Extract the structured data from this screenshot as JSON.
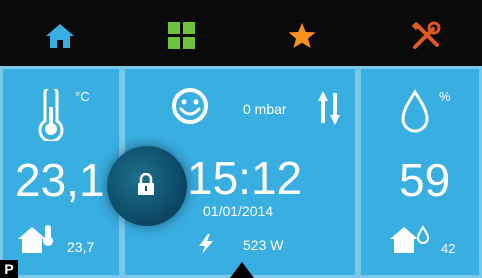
{
  "nav": {
    "items": [
      {
        "name": "home",
        "icon": "home-icon",
        "color": "#39aee0"
      },
      {
        "name": "grid",
        "icon": "grid-icon",
        "color": "#71c23b"
      },
      {
        "name": "favorites",
        "icon": "star-icon",
        "color": "#f6921e"
      },
      {
        "name": "settings",
        "icon": "tools-icon",
        "color": "#e05a1e"
      }
    ]
  },
  "left": {
    "unit": "°C",
    "temperature": "23,1",
    "inside_temp": "23,7"
  },
  "middle": {
    "pressure": "0 mbar",
    "time": "15:12",
    "date": "01/01/2014",
    "power": "523 W"
  },
  "right": {
    "unit": "%",
    "humidity": "59",
    "inside_humidity": "42"
  },
  "corner_label": "P",
  "colors": {
    "panel": "#39aee0",
    "panel_border": "#7ac7ea",
    "background": "#0a0a0a"
  }
}
